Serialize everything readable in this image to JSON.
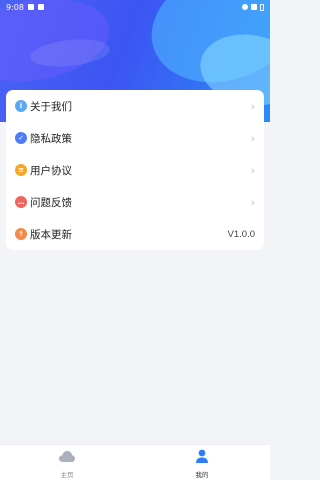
{
  "status_bar": {
    "time": "9:08"
  },
  "menu": {
    "items": [
      {
        "label": "关于我们",
        "icon": "info-icon",
        "color": "#5aa8f5",
        "glyph": "i",
        "trailing": "›"
      },
      {
        "label": "隐私政策",
        "icon": "shield-icon",
        "color": "#4f7cf6",
        "glyph": "✓",
        "trailing": "›"
      },
      {
        "label": "用户协议",
        "icon": "agreement-icon",
        "color": "#f5a623",
        "glyph": "≡",
        "trailing": "›"
      },
      {
        "label": "问题反馈",
        "icon": "feedback-icon",
        "color": "#f0645e",
        "glyph": "…",
        "trailing": "›"
      },
      {
        "label": "版本更新",
        "icon": "update-icon",
        "color": "#f58a4a",
        "glyph": "↑",
        "trailing": "V1.0.0"
      }
    ]
  },
  "tabbar": {
    "home_label": "主页",
    "mine_label": "我的",
    "inactive_color": "#aab0bc",
    "active_color": "#2f7ef5"
  }
}
